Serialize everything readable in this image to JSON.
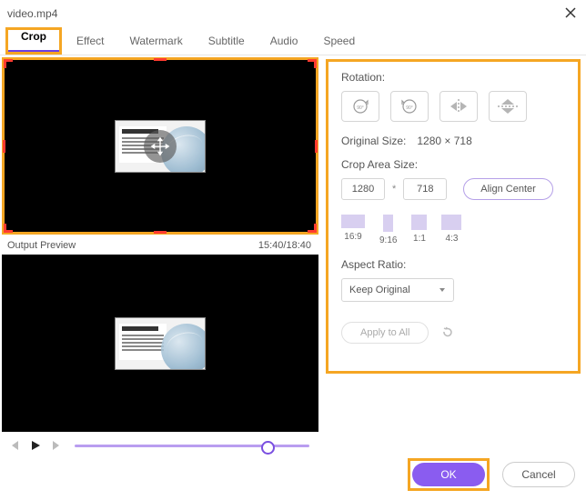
{
  "title": "video.mp4",
  "tabs": [
    "Crop",
    "Effect",
    "Watermark",
    "Subtitle",
    "Audio",
    "Speed"
  ],
  "active_tab": 0,
  "preview": {
    "label": "Output Preview",
    "time": "15:40/18:40"
  },
  "rotation": {
    "label": "Rotation:",
    "cw_label": "90°",
    "ccw_label": "90°"
  },
  "original": {
    "label": "Original Size:",
    "value": "1280 × 718"
  },
  "crop": {
    "label": "Crop Area Size:",
    "w": "1280",
    "h": "718",
    "times": "*",
    "align": "Align Center"
  },
  "ratios": {
    "r169": "16:9",
    "r916": "9:16",
    "r11": "1:1",
    "r43": "4:3"
  },
  "aspect": {
    "label": "Aspect Ratio:",
    "value": "Keep Original"
  },
  "apply": "Apply to All",
  "buttons": {
    "ok": "OK",
    "cancel": "Cancel"
  }
}
